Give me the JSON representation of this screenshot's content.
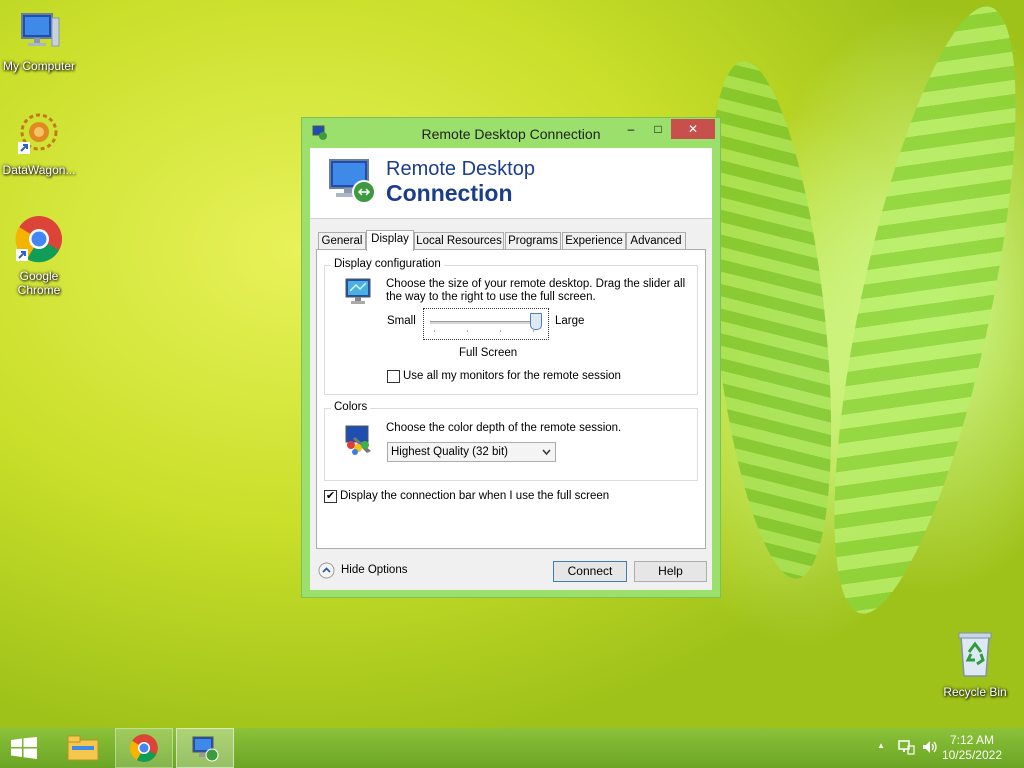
{
  "desktop": {
    "icons": [
      {
        "label": "My Computer",
        "icon": "computer-icon"
      },
      {
        "label": "DataWagon...",
        "icon": "datawagon-icon"
      },
      {
        "label": "Google Chrome",
        "icon": "chrome-icon"
      },
      {
        "label": "Recycle Bin",
        "icon": "recycle-bin-icon"
      }
    ]
  },
  "window": {
    "title": "Remote Desktop Connection",
    "controls": {
      "minimize": "–",
      "maximize": "□",
      "close": "✕"
    },
    "banner": {
      "line1": "Remote Desktop",
      "line2": "Connection"
    },
    "tabs": [
      "General",
      "Display",
      "Local Resources",
      "Programs",
      "Experience",
      "Advanced"
    ],
    "active_tab": "Display",
    "display_config": {
      "group_label": "Display configuration",
      "description": "Choose the size of your remote desktop. Drag the slider all the way to the right to use the full screen.",
      "slider_min_label": "Small",
      "slider_max_label": "Large",
      "slider_value_label": "Full Screen",
      "slider_position": 1.0,
      "monitors_checkbox": {
        "label": "Use all my monitors for the remote session",
        "checked": false
      }
    },
    "colors": {
      "group_label": "Colors",
      "description": "Choose the color depth of the remote session.",
      "selected": "Highest Quality (32 bit)"
    },
    "connection_bar_checkbox": {
      "label": "Display the connection bar when I use the full screen",
      "checked": true,
      "mark": "✔"
    },
    "hide_options": "Hide Options",
    "buttons": {
      "connect": "Connect",
      "help": "Help"
    }
  },
  "taskbar": {
    "items": [
      "start-icon",
      "file-explorer-icon",
      "chrome-icon",
      "remote-desktop-icon"
    ],
    "tray": {
      "up_arrow": "▲"
    },
    "clock": {
      "time": "7:12 AM",
      "date": "10/25/2022"
    }
  },
  "colors": {
    "accent": "#1a3e8c",
    "close": "#c7504d",
    "frame": "#9be06c",
    "taskbar": "#7ab52e"
  }
}
